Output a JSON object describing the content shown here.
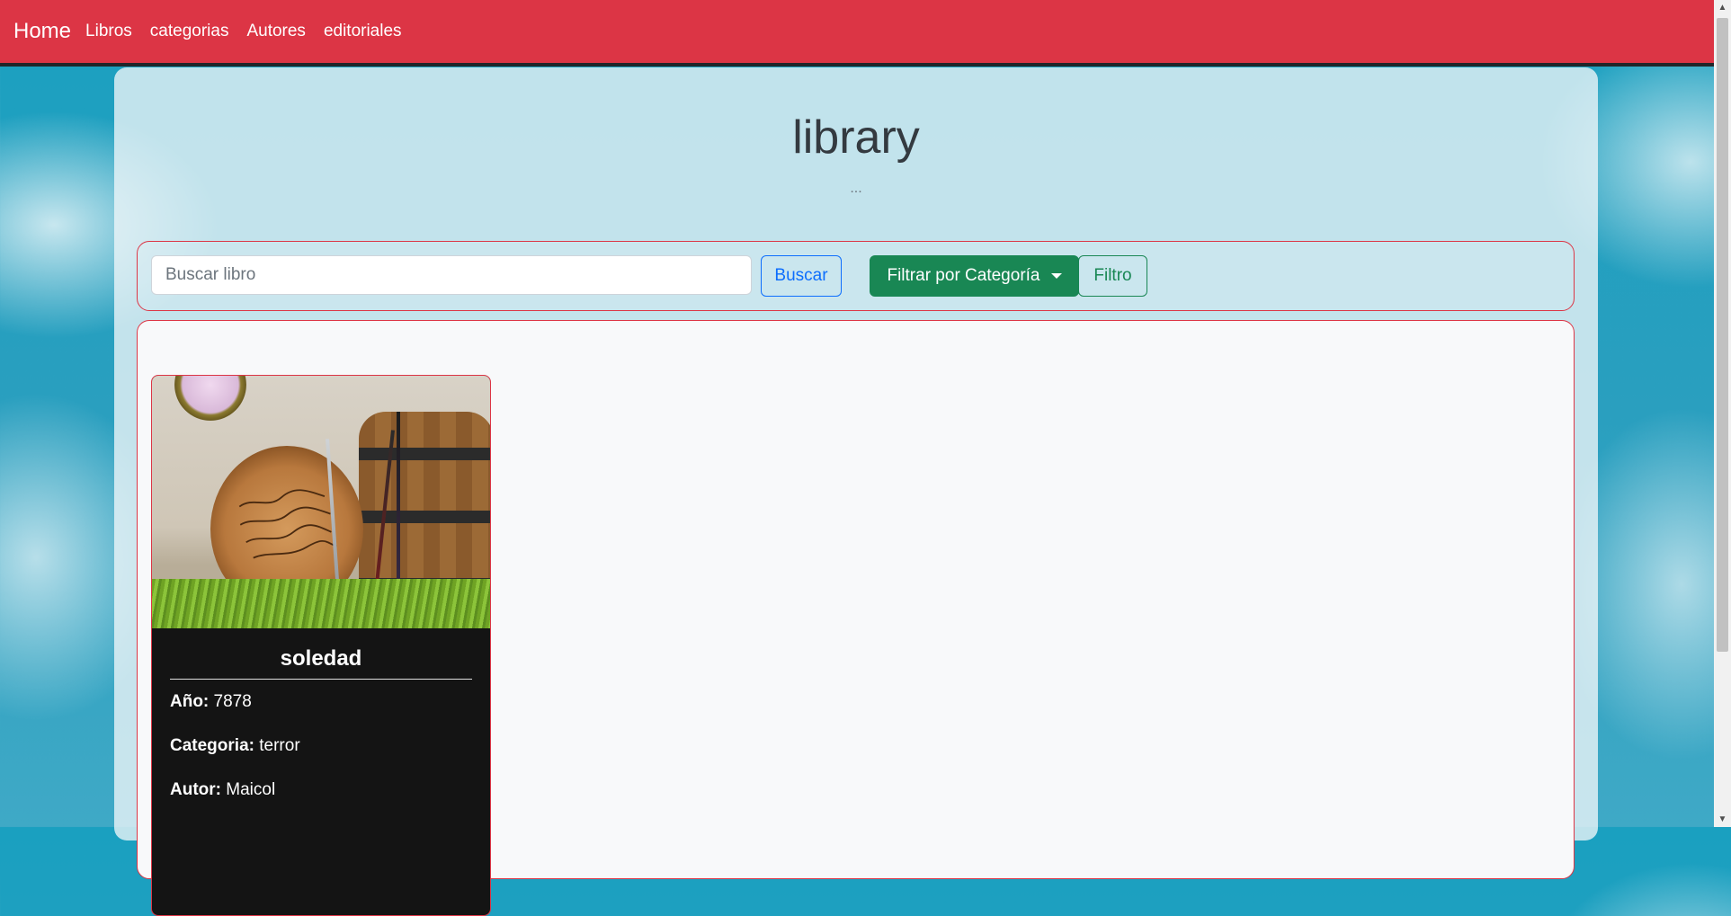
{
  "navbar": {
    "brand": "Home",
    "links": [
      "Libros",
      "categorias",
      "Autores",
      "editoriales"
    ]
  },
  "header": {
    "title": "library",
    "subtitle": "..."
  },
  "search": {
    "placeholder": "Buscar libro",
    "value": "",
    "search_button": "Buscar",
    "filter_dropdown": "Filtrar por Categoría",
    "filter_button": "Filtro"
  },
  "books": [
    {
      "title": "soledad",
      "year_label": "Año:",
      "year": "7878",
      "category_label": "Categoria:",
      "category": "terror",
      "author_label": "Autor:",
      "author": "Maicol",
      "cover_icon": "book-cover-image"
    }
  ],
  "colors": {
    "navbar": "#dc3545",
    "primary": "#0d6efd",
    "success": "#198754",
    "card": "#141414"
  }
}
